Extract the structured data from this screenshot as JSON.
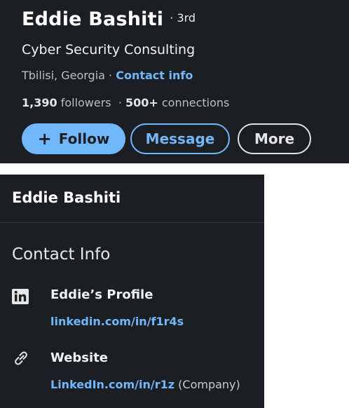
{
  "profile": {
    "name": "Eddie Bashiti",
    "degree": "· 3rd",
    "headline": "Cyber Security Consulting",
    "location": "Tbilisi, Georgia",
    "location_separator": " · ",
    "contact_info_label": "Contact info",
    "followers_count": "1,390",
    "followers_label": " followers",
    "stats_separator": "  · ",
    "connections_count": "500+",
    "connections_label": " connections"
  },
  "actions": {
    "follow_icon": "+",
    "follow_label": "Follow",
    "message_label": "Message",
    "more_label": "More"
  },
  "contact_panel": {
    "title": "Eddie Bashiti",
    "section_title": "Contact Info",
    "items": [
      {
        "icon": "linkedin-icon",
        "label": "Eddie’s Profile",
        "link": "linkedin.com/in/f1r4s",
        "note": ""
      },
      {
        "icon": "link-icon",
        "label": "Website",
        "link": "LinkedIn.com/in/r1z",
        "note": " (Company)"
      }
    ]
  },
  "colors": {
    "background": "#1b1f23",
    "accent": "#71b7fb",
    "text_primary": "#ffffff",
    "text_secondary": "#bcbfc3"
  }
}
